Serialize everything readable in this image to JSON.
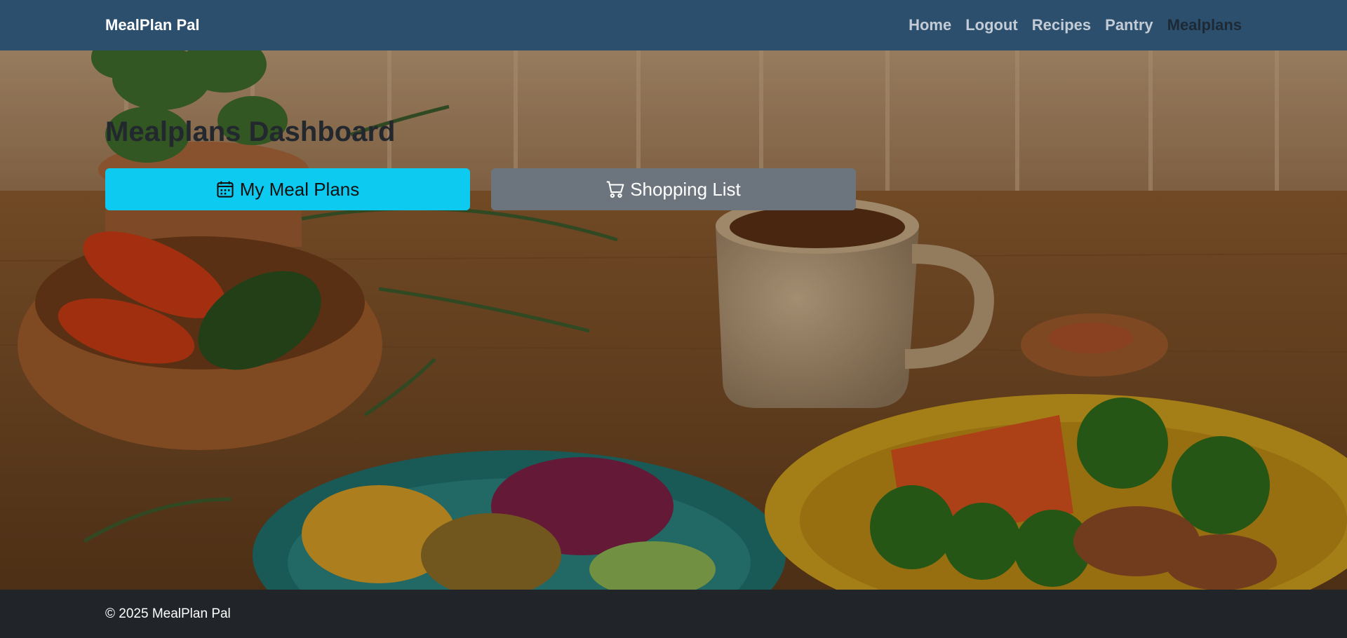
{
  "app": {
    "brand": "MealPlan Pal"
  },
  "nav": {
    "items": [
      {
        "label": "Home",
        "active": false
      },
      {
        "label": "Logout",
        "active": false
      },
      {
        "label": "Recipes",
        "active": false
      },
      {
        "label": "Pantry",
        "active": false
      },
      {
        "label": "Mealplans",
        "active": true
      }
    ]
  },
  "main": {
    "title": "Mealplans Dashboard",
    "buttons": {
      "meal_plans": {
        "label": "My Meal Plans",
        "icon": "calendar-icon"
      },
      "shopping_list": {
        "label": "Shopping List",
        "icon": "cart-icon"
      }
    }
  },
  "footer": {
    "text": "© 2025 MealPlan Pal"
  },
  "colors": {
    "navbar": "#2b4f6c",
    "primary_button": "#0dcaf0",
    "secondary_button": "#6c757d",
    "footer": "#212529"
  }
}
